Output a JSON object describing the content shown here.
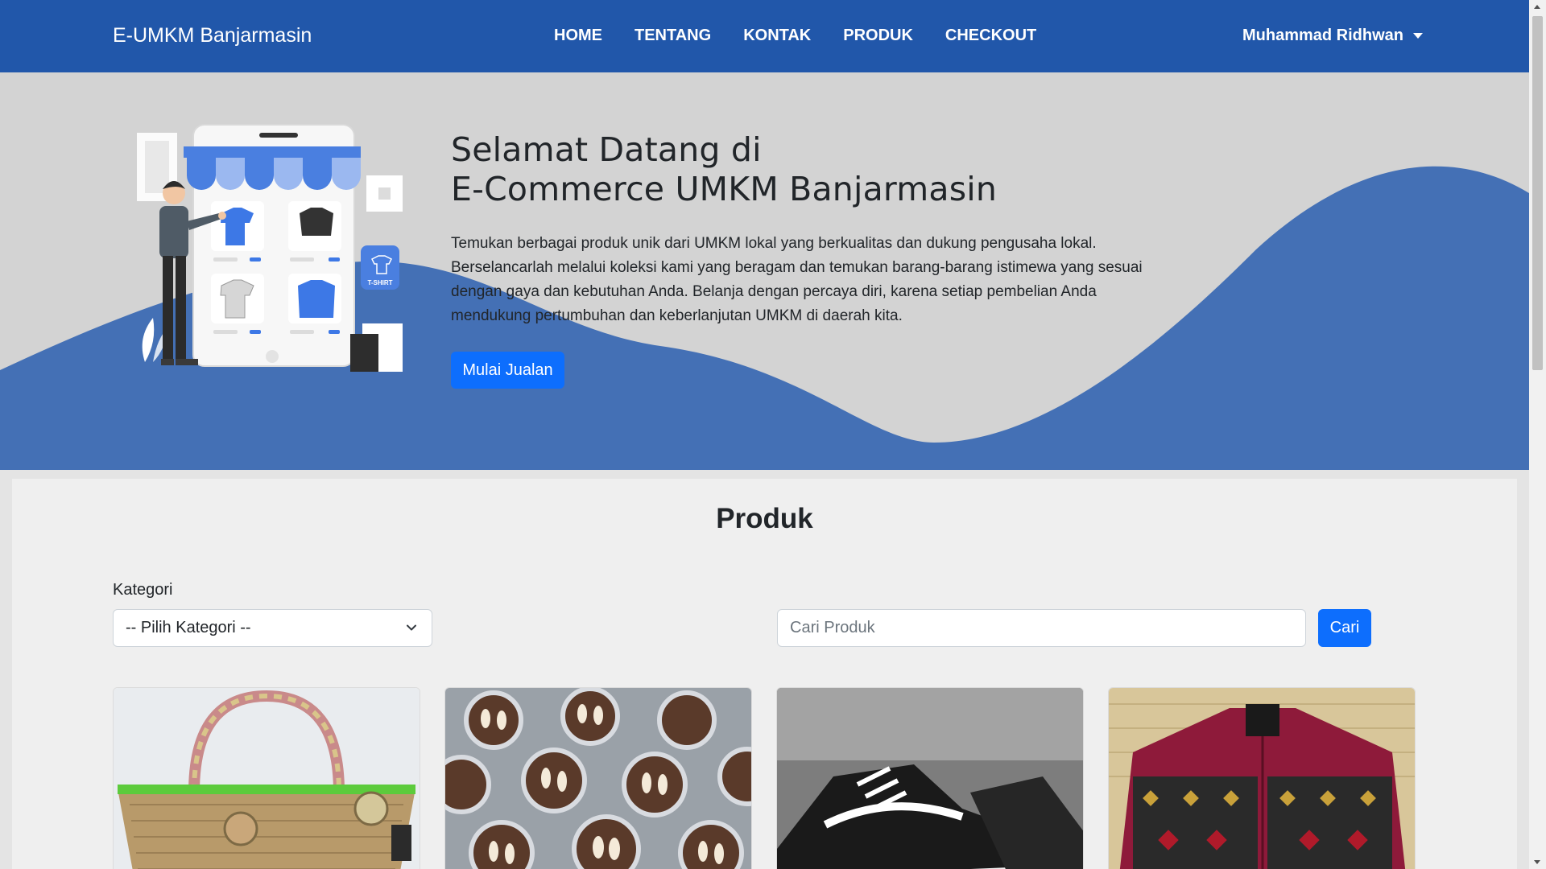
{
  "navbar": {
    "brand": "E-UMKM Banjarmasin",
    "links": [
      "HOME",
      "TENTANG",
      "KONTAK",
      "PRODUK",
      "CHECKOUT"
    ],
    "user": "Muhammad Ridhwan"
  },
  "hero": {
    "title_line1": "Selamat Datang di",
    "title_line2": "E-Commerce UMKM Banjarmasin",
    "text": "Temukan berbagai produk unik dari UMKM lokal yang berkualitas dan dukung pengusaha lokal. Berselancarlah melalui koleksi kami yang beragam dan temukan barang-barang istimewa yang sesuai dengan gaya dan kebutuhan Anda. Belanja dengan percaya diri, karena setiap pembelian Anda mendukung pertumbuhan dan keberlanjutan UMKM di daerah kita.",
    "button": "Mulai Jualan",
    "illustration_label": "T-SHIRT"
  },
  "products": {
    "title": "Produk",
    "category_label": "Kategori",
    "category_selected": "-- Pilih Kategori --",
    "search_placeholder": "Cari Produk",
    "search_button": "Cari",
    "items": [
      {
        "image": "woven-basket-image"
      },
      {
        "image": "chocolate-cupcakes-image"
      },
      {
        "image": "sneakers-image"
      },
      {
        "image": "batik-shirt-image"
      }
    ]
  },
  "colors": {
    "navbar": "#2157aa",
    "wave": "#4470b5",
    "primary_button": "#0d6efd"
  }
}
